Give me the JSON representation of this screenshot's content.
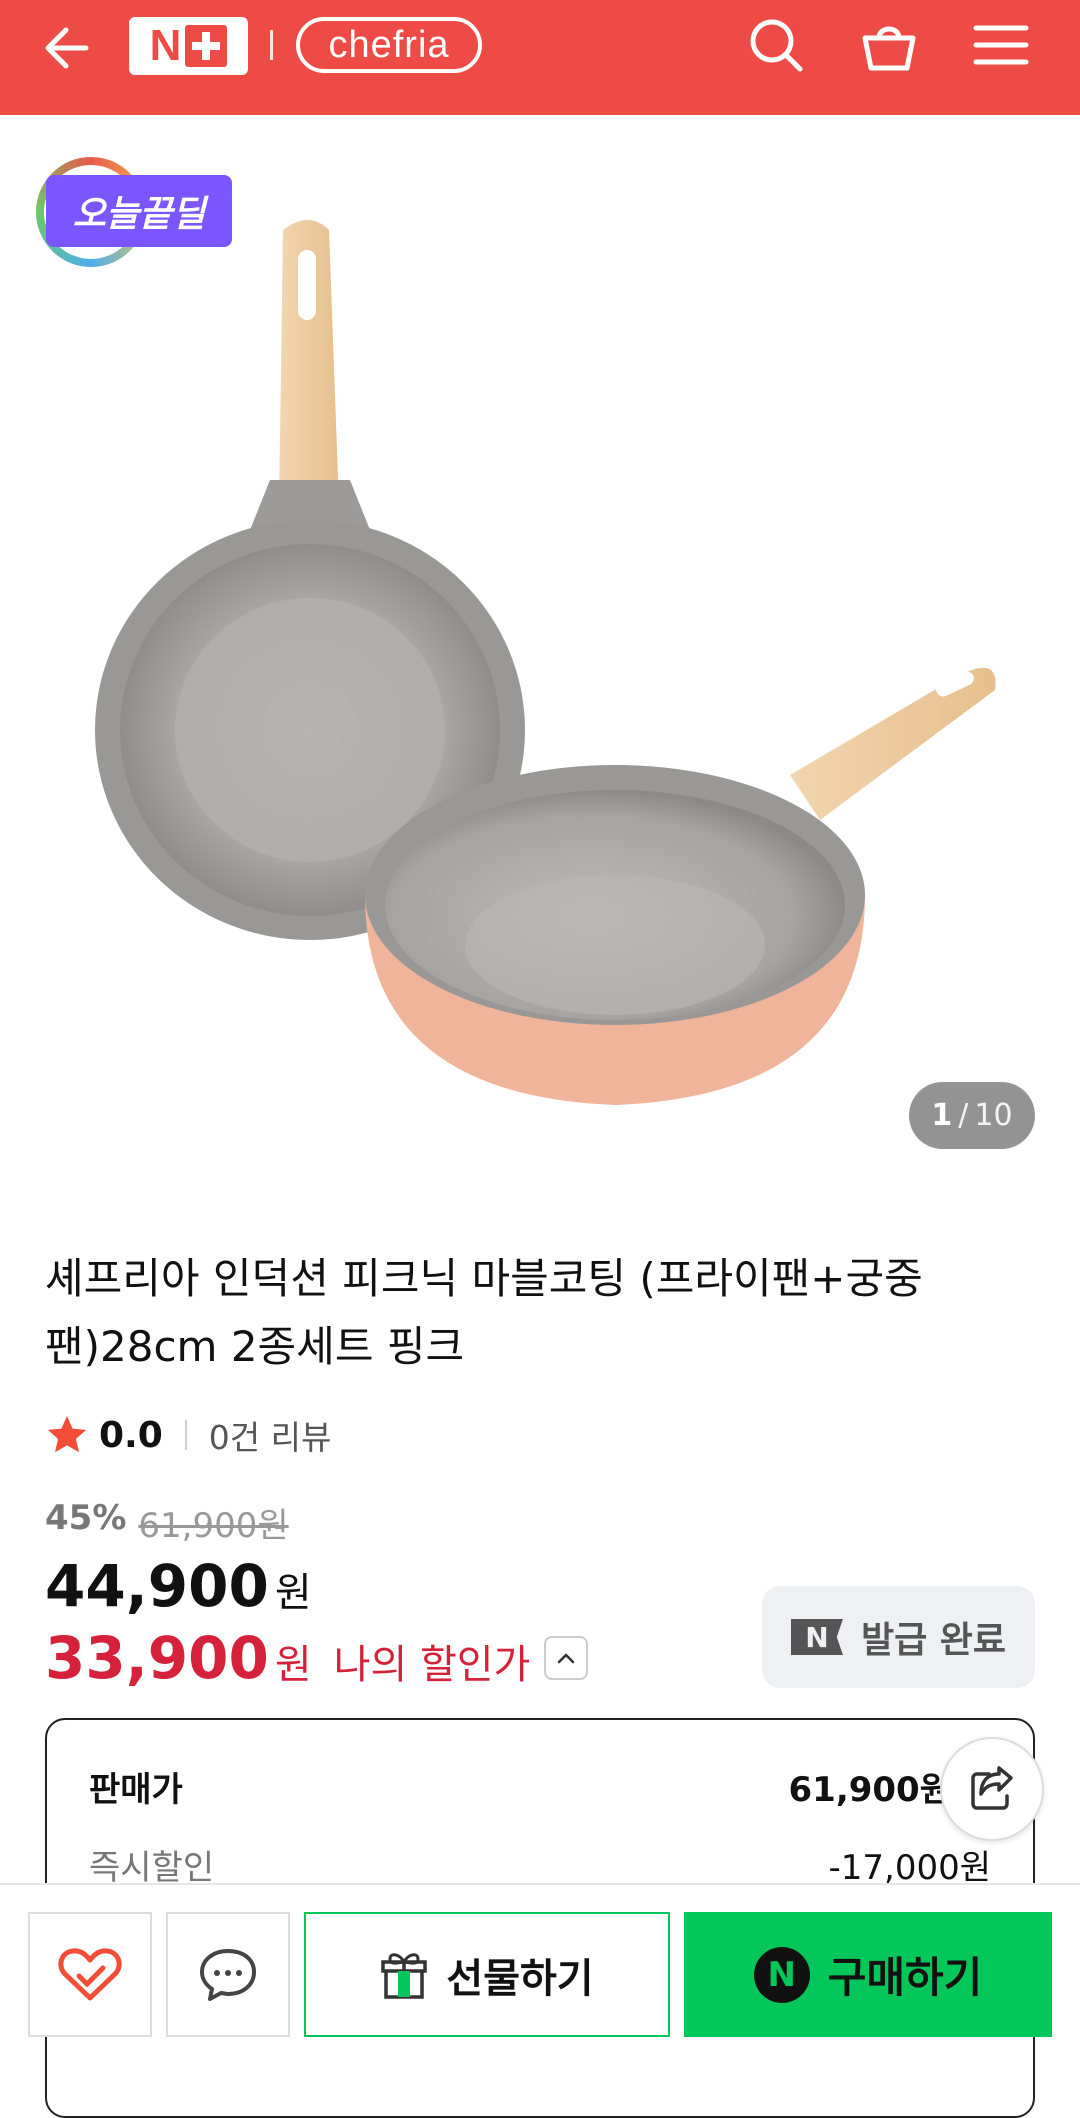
{
  "header": {
    "brand_np_letter": "N",
    "brand_logo_text": "chefria",
    "icons": [
      "back-arrow-icon",
      "search-icon",
      "cart-icon",
      "menu-icon"
    ],
    "bg_color": "#ef4b46"
  },
  "gallery": {
    "badge_label": "오늘끝딜",
    "current_index": "1",
    "separator": "/",
    "total": "10"
  },
  "product": {
    "title": "셰프리아 인덕션 피크닉 마블코팅 (프라이팬+궁중팬)28cm 2종세트 핑크",
    "rating_score": "0.0",
    "review_count": "0건 리뷰"
  },
  "price": {
    "discount_pct": "45%",
    "original_price": "61,900원",
    "sale_price": "44,900",
    "sale_unit": "원",
    "my_price": "33,900",
    "my_unit": "원",
    "my_label": "나의 할인가",
    "coupon_icon_letter": "N",
    "coupon_label": "발급 완료"
  },
  "price_detail": {
    "rows": [
      {
        "label": "판매가",
        "value": "61,900원"
      },
      {
        "label": "즉시할인",
        "value": "-17,000원"
      }
    ]
  },
  "bottom_bar": {
    "gift_label": "선물하기",
    "buy_label": "구매하기",
    "buy_icon_letter": "N",
    "accent_color": "#03c75a"
  }
}
